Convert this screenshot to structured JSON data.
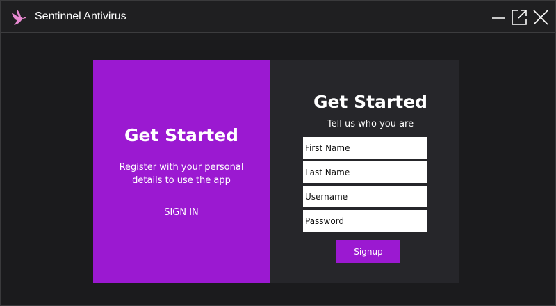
{
  "window": {
    "title": "Sentinnel Antivirus",
    "icon": "bird-logo-icon",
    "controls": [
      "minimize-icon",
      "popout-icon",
      "close-icon"
    ]
  },
  "colors": {
    "accent": "#9b19d1",
    "background": "#1b1b1d",
    "card": "#26262a",
    "titlebar": "#1f1f21",
    "logo": "#e88ad2"
  },
  "left_panel": {
    "heading": "Get Started",
    "description": "Register with your personal details to use the app",
    "signin_label": "SIGN IN"
  },
  "form": {
    "heading": "Get Started",
    "subheading": "Tell us who you are",
    "fields": [
      {
        "placeholder": "First Name",
        "value": ""
      },
      {
        "placeholder": "Last Name",
        "value": ""
      },
      {
        "placeholder": "Username",
        "value": ""
      },
      {
        "placeholder": "Password",
        "value": ""
      }
    ],
    "submit_label": "Signup"
  }
}
